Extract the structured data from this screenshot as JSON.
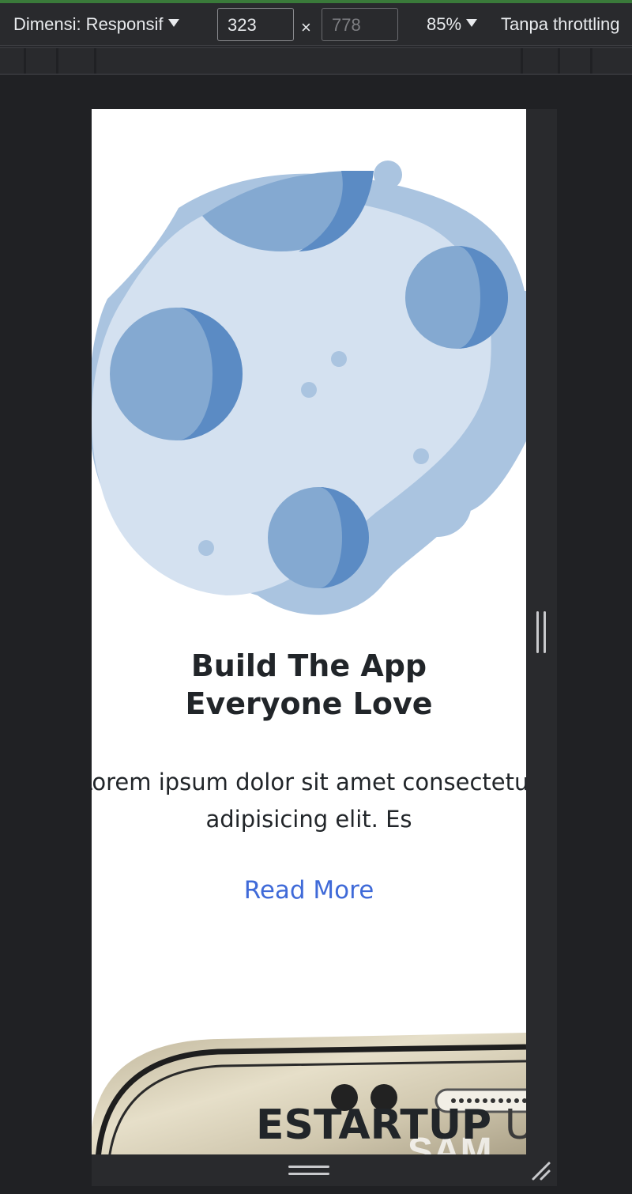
{
  "devtools": {
    "dimension_label": "Dimensi: Responsif",
    "width_value": "323",
    "height_placeholder": "778",
    "times_symbol": "×",
    "zoom": "85%",
    "throttling": "Tanpa throttling"
  },
  "page": {
    "title": "Build The App Everyone Love",
    "body": "Lorem ipsum dolor sit amet consectetur adipisicing elit. Es",
    "read_more": "Read More",
    "brand_bold": "ESTARTUP",
    "brand_light": " UI",
    "phone_brand_partial": "SAM"
  },
  "colors": {
    "link": "#3f6ad8",
    "planet_light": "#d4e1f0",
    "planet_ring": "#aac4e0",
    "crater_fill": "#84a9d1",
    "crater_shadow": "#5b8bc4"
  }
}
